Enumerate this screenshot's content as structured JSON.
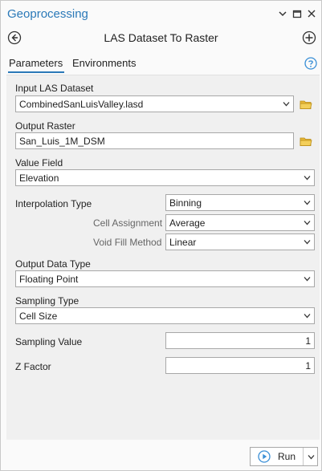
{
  "pane": {
    "title": "Geoprocessing",
    "tool_name": "LAS Dataset To Raster"
  },
  "tabs": [
    {
      "label": "Parameters",
      "active": true
    },
    {
      "label": "Environments",
      "active": false
    }
  ],
  "params": {
    "input_las": {
      "label": "Input LAS Dataset",
      "value": "CombinedSanLuisValley.lasd"
    },
    "output_raster": {
      "label": "Output Raster",
      "value": "San_Luis_1M_DSM"
    },
    "value_field": {
      "label": "Value Field",
      "value": "Elevation"
    },
    "interp_type": {
      "label": "Interpolation Type",
      "value": "Binning"
    },
    "cell_assignment": {
      "label": "Cell Assignment",
      "value": "Average"
    },
    "void_fill": {
      "label": "Void Fill Method",
      "value": "Linear"
    },
    "output_data_type": {
      "label": "Output Data Type",
      "value": "Floating Point"
    },
    "sampling_type": {
      "label": "Sampling Type",
      "value": "Cell Size"
    },
    "sampling_value": {
      "label": "Sampling Value",
      "value": "1"
    },
    "z_factor": {
      "label": "Z Factor",
      "value": "1"
    }
  },
  "run": {
    "label": "Run"
  },
  "colors": {
    "accent": "#2a79b8",
    "run_icon": "#3a8fd6"
  },
  "icons": [
    "chevron-down-icon",
    "pin-icon",
    "close-icon",
    "back-icon",
    "add-icon",
    "help-icon",
    "folder-icon",
    "run-icon"
  ]
}
